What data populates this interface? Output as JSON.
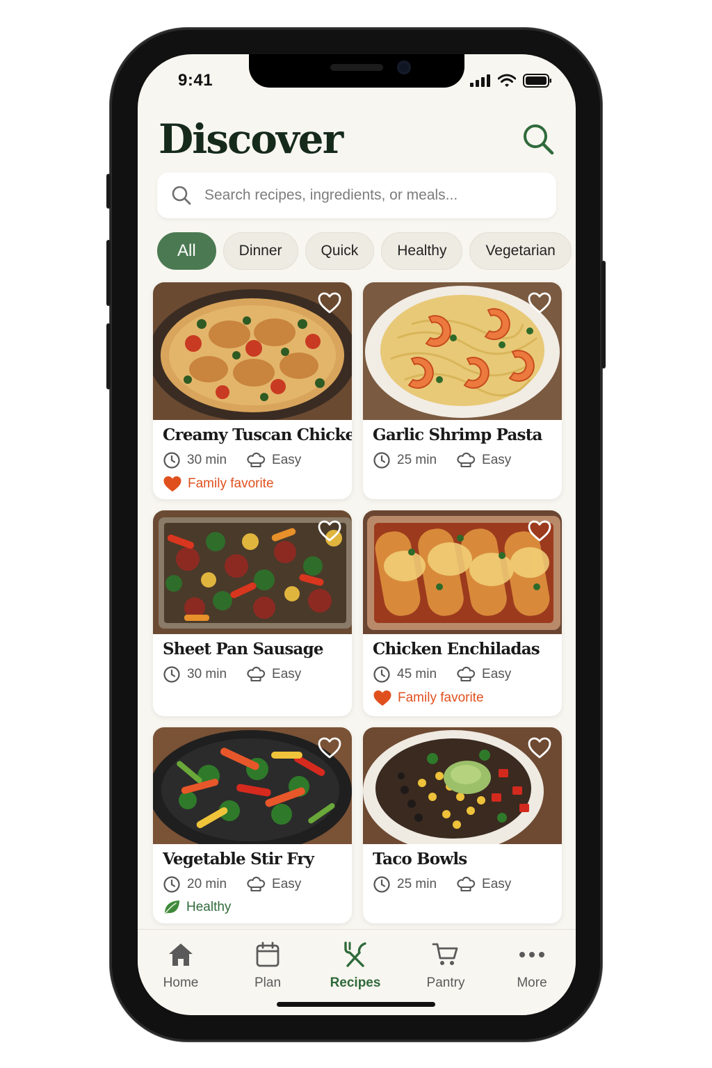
{
  "status": {
    "time": "9:41"
  },
  "header": {
    "title": "Discover"
  },
  "search": {
    "placeholder": "Search recipes, ingredients, or meals..."
  },
  "filters": [
    "All",
    "Dinner",
    "Quick",
    "Healthy",
    "Vegetarian"
  ],
  "recipes": [
    {
      "name": "Creamy Tuscan Chicken",
      "time": "30 min",
      "difficulty": "Easy",
      "badge": "Family favorite",
      "badge_type": "heart"
    },
    {
      "name": "Garlic Shrimp Pasta",
      "time": "25 min",
      "difficulty": "Easy",
      "badge": "",
      "badge_type": ""
    },
    {
      "name": "Sheet Pan Sausage",
      "time": "30 min",
      "difficulty": "Easy",
      "badge": "",
      "badge_type": ""
    },
    {
      "name": "Chicken Enchiladas",
      "time": "45 min",
      "difficulty": "Easy",
      "badge": "Family favorite",
      "badge_type": "heart"
    },
    {
      "name": "Vegetable Stir Fry",
      "time": "20 min",
      "difficulty": "Easy",
      "badge": "Healthy",
      "badge_type": "leaf"
    },
    {
      "name": "Taco Bowls",
      "time": "25 min",
      "difficulty": "Easy",
      "badge": "",
      "badge_type": ""
    }
  ],
  "tabs": [
    {
      "label": "Home",
      "icon": "home-icon"
    },
    {
      "label": "Plan",
      "icon": "calendar-icon"
    },
    {
      "label": "Recipes",
      "icon": "utensils-icon"
    },
    {
      "label": "Pantry",
      "icon": "cart-icon"
    },
    {
      "label": "More",
      "icon": "more-icon"
    }
  ],
  "active_tab": "Recipes",
  "colors": {
    "accent": "#4b7a52",
    "active_tab": "#2f6a3b",
    "favorite": "#e0501e",
    "healthy": "#2f6a3b",
    "background": "#f8f6f0"
  }
}
